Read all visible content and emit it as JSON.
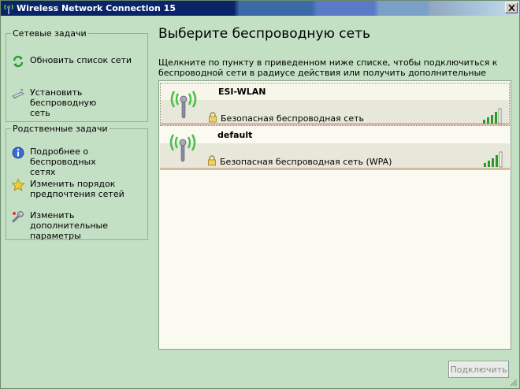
{
  "window": {
    "title": "Wireless Network Connection 15"
  },
  "network_tasks": {
    "label": "Сетевые задачи",
    "items": [
      {
        "line1": "Обновить список сети",
        "line2": "",
        "icon": "refresh-icon"
      },
      {
        "line1": "Установить беспроводную",
        "line2": "сеть",
        "icon": "wireless-setup-icon"
      }
    ]
  },
  "related_tasks": {
    "label": "Родственные задачи",
    "items": [
      {
        "line1": "Подробнее о беспроводных",
        "line2": "сетях",
        "icon": "info-icon"
      },
      {
        "line1": "Изменить порядок",
        "line2": "предпочтения  сетей",
        "icon": "star-icon"
      },
      {
        "line1": "Изменить дополнительные",
        "line2": "параметры",
        "icon": "wrench-icon"
      }
    ]
  },
  "main": {
    "heading": "Выберите беспроводную сеть",
    "description_line1": "Щелкните по пункту в приведенном ниже списке, чтобы подключиться к",
    "description_line2": "беспроводной сети в радиусе действия или получить дополнительные сведения."
  },
  "networks": [
    {
      "name": "ESI-WLAN",
      "security": "Безопасная беспроводная сеть",
      "selected": true,
      "signal_bars": 4
    },
    {
      "name": "default",
      "security": "Безопасная беспроводная сеть (WPA)",
      "selected": false,
      "signal_bars": 4
    }
  ],
  "connect_button": {
    "label": "Подключить",
    "enabled": false
  },
  "colors": {
    "accent": "#0a246a",
    "panel": "#c4e0c4",
    "list_bg": "#fafaf0",
    "signal": "#2a9a2a"
  }
}
